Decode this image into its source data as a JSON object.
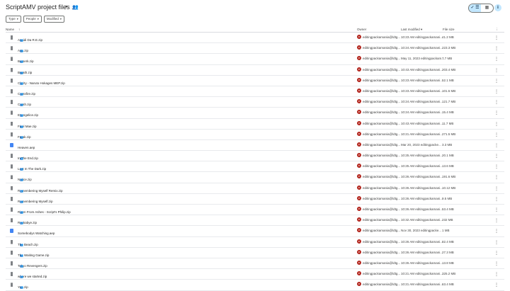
{
  "header": {
    "title": "ScriptAMV project files ...",
    "caret": "▾",
    "view_list_icon": "✓ ☰",
    "view_grid_icon": "▦",
    "info_icon": "i"
  },
  "filters": [
    {
      "label": "Type",
      "caret": "▾"
    },
    {
      "label": "People",
      "caret": "▾"
    },
    {
      "label": "Modified",
      "caret": "▾"
    }
  ],
  "columns": {
    "name": "Name",
    "sort_arrow": "↑",
    "owner": "Owner",
    "last_modified": "Last modified ▾",
    "file_size": "File size",
    "more": "⋮"
  },
  "files": [
    {
      "name": "Asaidi Da R.E.zip",
      "type": "zip",
      "owner": "editingpackamania@ldtg...",
      "modified": "10:23 AM editingpackamani...",
      "size": "41.2 MB"
    },
    {
      "name": "Arts.zip",
      "type": "zip",
      "owner": "editingpackamania@ldtg...",
      "modified": "10:24 AM editingpackamani...",
      "size": "223.3 MB"
    },
    {
      "name": "Berserk.zip",
      "type": "zip",
      "owner": "editingpackamania@ldtg...",
      "modified": "May 11, 2023 editingpackam...",
      "size": "7.7 MB"
    },
    {
      "name": "Breath.zip",
      "type": "zip",
      "owner": "editingpackamania@ldtg...",
      "modified": "10:43 AM editingpackamani...",
      "size": "203.4 MB"
    },
    {
      "name": "Clarity - Naruto Hokages MEP.zip",
      "type": "zip",
      "owner": "editingpackamania@ldtg...",
      "modified": "10:23 AM editingpackamani...",
      "size": "52.1 MB"
    },
    {
      "name": "Crossfire.zip",
      "type": "zip",
      "owner": "editingpackamania@ldtg...",
      "modified": "10:23 AM editingpackamani...",
      "size": "101.5 MB"
    },
    {
      "name": "Crush.zip",
      "type": "zip",
      "owner": "editingpackamania@ldtg...",
      "modified": "10:24 AM editingpackamani...",
      "size": "121.7 MB"
    },
    {
      "name": "Evangelice.zip",
      "type": "zip",
      "owner": "editingpackamania@ldtg...",
      "modified": "10:24 AM editingpackamani...",
      "size": "15.4 MB"
    },
    {
      "name": "Fivel Mae.zip",
      "type": "zip",
      "owner": "editingpackamania@ldtg...",
      "modified": "10:43 AM editingpackamani...",
      "size": "11.7 MB"
    },
    {
      "name": "Freak.zip",
      "type": "zip",
      "owner": "editingpackamania@ldtg...",
      "modified": "10:21 AM editingpackamani...",
      "size": "271.5 MB"
    },
    {
      "name": "Heaven.aep",
      "type": "doc",
      "owner": "editingpackamania@ldtg...",
      "modified": "Mar 20, 2023 editingpacke...",
      "size": "3.3 MB"
    },
    {
      "name": "In The End.zip",
      "type": "zip",
      "owner": "editingpackamania@ldtg...",
      "modified": "10:25 AM editingpackamani...",
      "size": "20.1 MB"
    },
    {
      "name": "Lost In The Dark.zip",
      "type": "zip",
      "owner": "editingpackamania@ldtg...",
      "modified": "10:25 AM editingpackamani...",
      "size": "13.6 MB"
    },
    {
      "name": "Notice.zip",
      "type": "zip",
      "owner": "editingpackamania@ldtg...",
      "modified": "10:26 AM editingpackamani...",
      "size": "191.6 MB"
    },
    {
      "name": "Remembering Myself Remix.zip",
      "type": "zip",
      "owner": "editingpackamania@ldtg...",
      "modified": "10:26 AM editingpackamani...",
      "size": "10.12 MB"
    },
    {
      "name": "Remembering Myself.zip",
      "type": "zip",
      "owner": "editingpackamania@ldtg...",
      "modified": "10:26 AM editingpackamani...",
      "size": "9.5 MB"
    },
    {
      "name": "Risen From Ashes - Script's Philip.zip",
      "type": "zip",
      "owner": "editingpackamania@ldtg...",
      "modified": "10:26 AM editingpackamani...",
      "size": "53.4 MB"
    },
    {
      "name": "Rockabye.zip",
      "type": "zip",
      "owner": "editingpackamania@ldtg...",
      "modified": "10:32 AM editingpackamani...",
      "size": "232 MB"
    },
    {
      "name": "Somebodys Watching.aep",
      "type": "doc",
      "owner": "editingpackamania@ldtg...",
      "modified": "Nov 30, 2023 editingpacke...",
      "size": "1 MB"
    },
    {
      "name": "The Beach.zip",
      "type": "zip",
      "owner": "editingpackamania@ldtg...",
      "modified": "10:26 AM editingpackamani...",
      "size": "82.4 MB"
    },
    {
      "name": "The Waiting Game.zip",
      "type": "zip",
      "owner": "editingpackamania@ldtg...",
      "modified": "10:26 AM editingpackamani...",
      "size": "27.3 MB"
    },
    {
      "name": "Tokyo Revengers.zip",
      "type": "zip",
      "owner": "editingpackamania@ldtg...",
      "modified": "10:26 AM editingpackamani...",
      "size": "13.8 MB"
    },
    {
      "name": "where we started.zip",
      "type": "zip",
      "owner": "editingpackamania@ldtg...",
      "modified": "10:21 AM editingpackamani...",
      "size": "325.2 MB"
    },
    {
      "name": "You.zip",
      "type": "zip",
      "owner": "editingpackamania@ldtg...",
      "modified": "10:21 AM editingpackamani...",
      "size": "63.4 MB"
    }
  ],
  "shared_icon": "👥",
  "avatar_letter": "e",
  "more_icon": "⋮"
}
